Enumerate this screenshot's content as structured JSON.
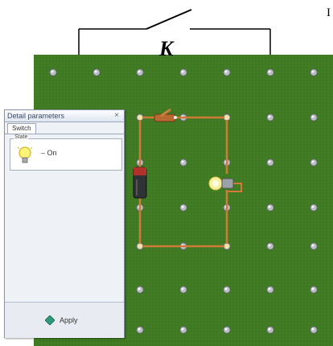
{
  "diagram": {
    "switch_label": "K",
    "corner_letter": "I"
  },
  "panel": {
    "title": "Detail parameters",
    "close_glyph": "×",
    "tab_label": "Switch",
    "state_legend": "State",
    "state_value": "On",
    "state_dash": "–",
    "apply_label": "Apply"
  },
  "board": {
    "color": "#3f7a22",
    "wire_color": "#d07a3a",
    "pin_color": "#b9bfc4"
  }
}
